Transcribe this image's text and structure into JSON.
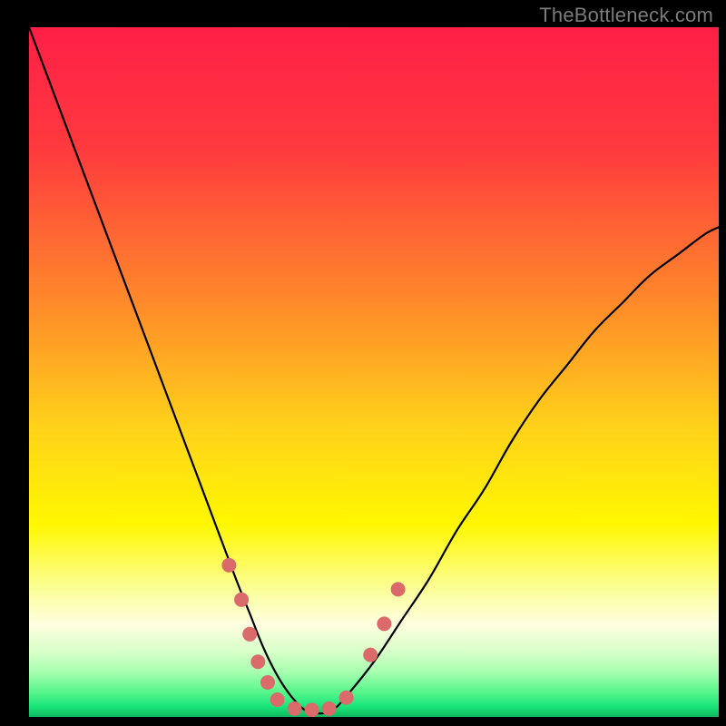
{
  "watermark": "TheBottleneck.com",
  "chart_data": {
    "type": "line",
    "title": "",
    "xlabel": "",
    "ylabel": "",
    "xlim": [
      0,
      100
    ],
    "ylim": [
      0,
      100
    ],
    "grid": false,
    "legend": false,
    "background_gradient_stops": [
      {
        "offset": 0.0,
        "color": "#ff1f47"
      },
      {
        "offset": 0.18,
        "color": "#ff3b3e"
      },
      {
        "offset": 0.4,
        "color": "#ff8a2a"
      },
      {
        "offset": 0.58,
        "color": "#ffd21a"
      },
      {
        "offset": 0.72,
        "color": "#fff700"
      },
      {
        "offset": 0.82,
        "color": "#fbffa0"
      },
      {
        "offset": 0.865,
        "color": "#fffee0"
      },
      {
        "offset": 0.905,
        "color": "#d8ffc8"
      },
      {
        "offset": 0.935,
        "color": "#a6ffb0"
      },
      {
        "offset": 0.965,
        "color": "#55f58a"
      },
      {
        "offset": 0.985,
        "color": "#18e47a"
      },
      {
        "offset": 1.0,
        "color": "#0fb85e"
      }
    ],
    "series": [
      {
        "name": "bottleneck-curve",
        "color": "#000000",
        "stroke_width": 2.2,
        "x": [
          0,
          3,
          6,
          9,
          12,
          15,
          18,
          21,
          24,
          27,
          30,
          32,
          34,
          36,
          38,
          40,
          42,
          44,
          46,
          50,
          54,
          58,
          62,
          66,
          70,
          74,
          78,
          82,
          86,
          90,
          94,
          98,
          100
        ],
        "values": [
          100,
          92,
          84,
          76,
          68,
          60,
          52,
          44,
          36,
          28,
          20,
          15,
          10,
          6,
          3,
          1,
          0.5,
          1,
          3,
          8,
          14,
          20,
          27,
          33,
          40,
          46,
          51,
          56,
          60,
          64,
          67,
          70,
          71
        ]
      }
    ],
    "markers": {
      "name": "highlight-near-minimum",
      "color": "#db6b6b",
      "radius": 8,
      "points": [
        {
          "x": 29.0,
          "y": 22
        },
        {
          "x": 30.8,
          "y": 17
        },
        {
          "x": 32.0,
          "y": 12
        },
        {
          "x": 33.2,
          "y": 8
        },
        {
          "x": 34.6,
          "y": 5
        },
        {
          "x": 36.0,
          "y": 2.5
        },
        {
          "x": 38.5,
          "y": 1.2
        },
        {
          "x": 41.0,
          "y": 1.0
        },
        {
          "x": 43.5,
          "y": 1.2
        },
        {
          "x": 46.0,
          "y": 2.8
        },
        {
          "x": 49.5,
          "y": 9
        },
        {
          "x": 51.5,
          "y": 13.5
        },
        {
          "x": 53.5,
          "y": 18.5
        }
      ]
    }
  }
}
